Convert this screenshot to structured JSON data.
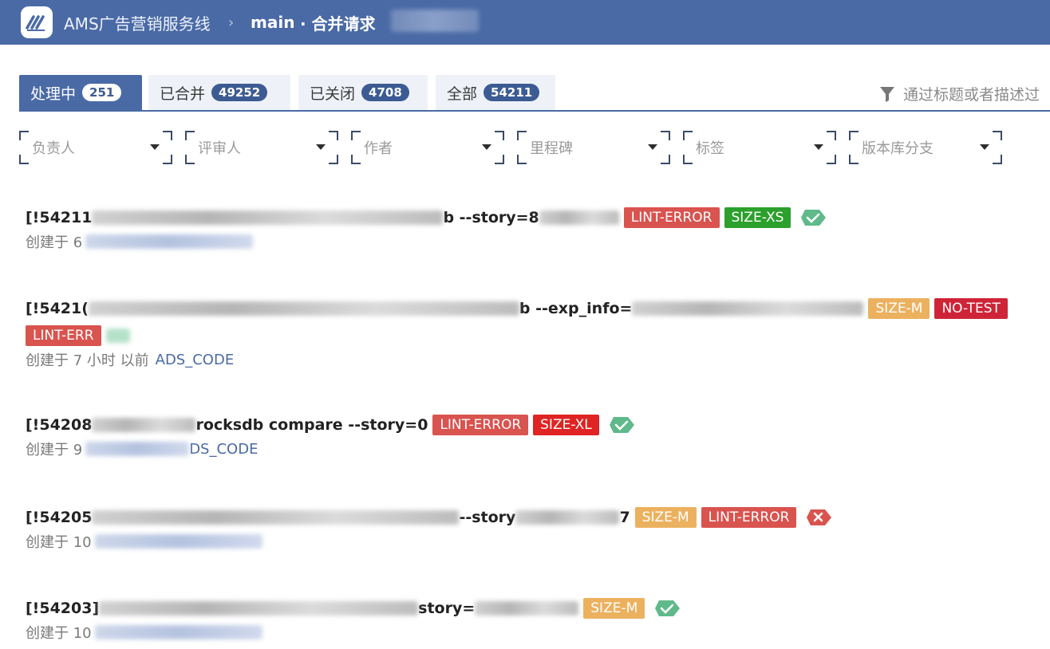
{
  "header": {
    "app_name": "AMS广告营销服务线",
    "separator": "›",
    "branch": "main",
    "page": "· 合并请求"
  },
  "tabs": [
    {
      "label": "处理中",
      "count": "251",
      "active": true
    },
    {
      "label": "已合并",
      "count": "49252",
      "active": false
    },
    {
      "label": "已关闭",
      "count": "4708",
      "active": false
    },
    {
      "label": "全部",
      "count": "54211",
      "active": false
    }
  ],
  "search": {
    "placeholder": "通过标题或者描述过"
  },
  "filters": [
    "负责人",
    "评审人",
    "作者",
    "里程碑",
    "标签",
    "版本库分支"
  ],
  "merge_requests": [
    {
      "id_prefix": "[!54211",
      "title_fragment": "b --story=8",
      "labels": [
        "LINT-ERROR",
        "SIZE-XS"
      ],
      "status": "success",
      "meta_prefix": "创建于 6",
      "meta_suffix": ""
    },
    {
      "id_prefix": "[!5421(",
      "title_fragment": "b --exp_info=",
      "labels": [
        "SIZE-M",
        "NO-TEST"
      ],
      "labels_second_line": [
        "LINT-ERR"
      ],
      "status": "success",
      "meta_prefix": "创建于 7 小时 以前",
      "meta_suffix": "ADS_CODE"
    },
    {
      "id_prefix": "[!54208",
      "title_fragment": "rocksdb compare --story=0",
      "labels": [
        "LINT-ERROR",
        "SIZE-XL"
      ],
      "status": "success",
      "meta_prefix": "创建于 9",
      "meta_suffix": "DS_CODE"
    },
    {
      "id_prefix": "[!54205",
      "title_fragment": "--story",
      "title_suffix": "7",
      "labels": [
        "SIZE-M",
        "LINT-ERROR"
      ],
      "status": "failed",
      "meta_prefix": "创建于 10",
      "meta_suffix": ""
    },
    {
      "id_prefix": "[!54203]",
      "title_fragment": "story=",
      "labels": [
        "SIZE-M"
      ],
      "status": "success",
      "meta_prefix": "创建于 10",
      "meta_suffix": ""
    }
  ],
  "colors": {
    "header_bg": "#4a6aa6",
    "lint_error": "#d9534f",
    "size_xs": "#2ca02c",
    "size_m": "#ecb15f",
    "no_test": "#cf2437",
    "size_xl": "#e02424",
    "status_success": "#5fb98a",
    "status_failed": "#d9534f"
  }
}
